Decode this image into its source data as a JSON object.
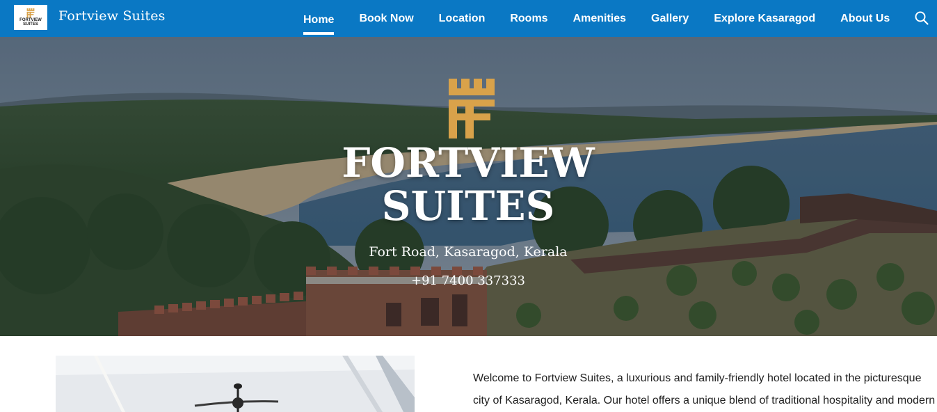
{
  "brand": {
    "logo_text": "FORTVIEW SUITES",
    "name": "Fortview Suites",
    "accent_color": "#0a78c4",
    "logo_gold": "#d9a24a"
  },
  "nav": {
    "items": [
      {
        "label": "Home",
        "active": true
      },
      {
        "label": "Book Now"
      },
      {
        "label": "Location"
      },
      {
        "label": "Rooms"
      },
      {
        "label": "Amenities"
      },
      {
        "label": "Gallery"
      },
      {
        "label": "Explore Kasaragod"
      },
      {
        "label": "About Us"
      }
    ],
    "search_icon": "search-icon"
  },
  "hero": {
    "title_line1": "FORTVIEW",
    "title_line2": "SUITES",
    "address": "Fort Road, Kasaragod, Kerala",
    "phone": "+91 7400 337333"
  },
  "intro": {
    "line1": "Welcome to Fortview Suites, a luxurious and family-friendly hotel located in the picturesque",
    "line2": "city of Kasaragod, Kerala. Our hotel offers a unique blend of traditional hospitality and modern"
  }
}
